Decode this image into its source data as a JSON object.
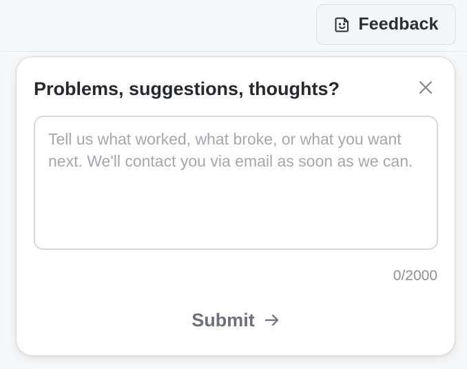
{
  "header": {
    "feedback_button": {
      "label": "Feedback",
      "icon": "smiley-note-icon"
    }
  },
  "feedback_panel": {
    "title": "Problems, suggestions, thoughts?",
    "close_icon": "close-icon",
    "textarea": {
      "value": "",
      "placeholder": "Tell us what worked, what broke, or what you want next. We'll contact you via email as soon as we can."
    },
    "char_count": "0/2000",
    "submit": {
      "label": "Submit",
      "icon": "arrow-right-icon"
    }
  },
  "colors": {
    "page_background": "#f6f7f8",
    "panel_background": "#ffffff",
    "border": "#d9dadd",
    "title_text": "#25282c",
    "placeholder_text": "#a3a6ab",
    "muted_text": "#8c9096",
    "submit_text": "#6c707a"
  }
}
